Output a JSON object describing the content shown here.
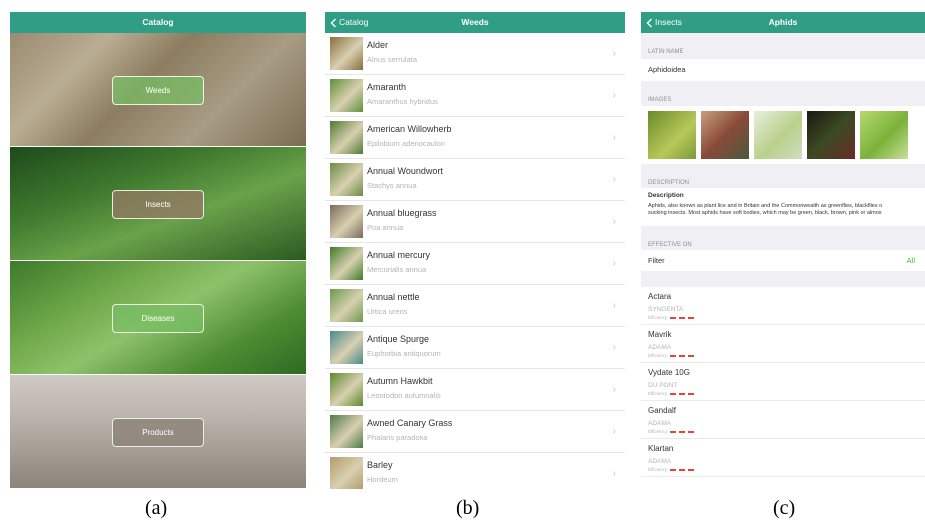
{
  "panel_a": {
    "title": "Catalog",
    "categories": [
      {
        "label": "Weeds"
      },
      {
        "label": "Insects"
      },
      {
        "label": "Diseases"
      },
      {
        "label": "Products"
      }
    ]
  },
  "panel_b": {
    "back_label": "Catalog",
    "title": "Weeds",
    "items": [
      {
        "name": "Alder",
        "latin": "Alnus serrulata",
        "thumb_color": "#8a6d3b"
      },
      {
        "name": "Amaranth",
        "latin": "Amaranthus hybridus",
        "thumb_color": "#5f8f3a"
      },
      {
        "name": "American Willowherb",
        "latin": "Epilobium adenocaulon",
        "thumb_color": "#4e7a33"
      },
      {
        "name": "Annual Woundwort",
        "latin": "Stachys annua",
        "thumb_color": "#6d8a45"
      },
      {
        "name": "Annual bluegrass",
        "latin": "Poa annua",
        "thumb_color": "#7a6a5a"
      },
      {
        "name": "Annual mercury",
        "latin": "Mercurialis annua",
        "thumb_color": "#3f7a2a"
      },
      {
        "name": "Annual nettle",
        "latin": "Urtica urens",
        "thumb_color": "#6a9a4a"
      },
      {
        "name": "Antique Spurge",
        "latin": "Euphorbia antiquorum",
        "thumb_color": "#4a8a8a"
      },
      {
        "name": "Autumn Hawkbit",
        "latin": "Leontodon autumnalis",
        "thumb_color": "#5a8a2a"
      },
      {
        "name": "Awned Canary Grass",
        "latin": "Phalaris paradoxa",
        "thumb_color": "#4f7a4a"
      },
      {
        "name": "Barley",
        "latin": "Hordeum",
        "thumb_color": "#b59a6a"
      }
    ]
  },
  "panel_c": {
    "back_label": "Insects",
    "title": "Aphids",
    "latin_header": "LATIN NAME",
    "latin_name": "Aphidoidea",
    "images_header": "IMAGES",
    "image_colors": [
      "#9ab84a",
      "#c27a5a",
      "#c9d9a0",
      "#2a2a1a",
      "#8ab840"
    ],
    "description_header": "DESCRIPTION",
    "description_title": "Description",
    "description_text": "Aphids, also known as plant lice and in Britain and the Commonwealth as greenflies, blackflies o",
    "description_text_2": "sucking insects. Most aphids have soft bodies, which may be green, black, brown, pink or almos",
    "effective_header": "EFFECTIVE ON",
    "filter_label": "Filter",
    "filter_value": "All",
    "efficiency_label": "Efficiency",
    "products": [
      {
        "name": "Actara",
        "company": "SYNGENTA"
      },
      {
        "name": "Mavrik",
        "company": "ADAMA"
      },
      {
        "name": "Vydate 10G",
        "company": "DU PONT"
      },
      {
        "name": "Gandalf",
        "company": "ADAMA"
      },
      {
        "name": "Klartan",
        "company": "ADAMA"
      }
    ]
  },
  "captions": {
    "a": "(a)",
    "b": "(b)",
    "c": "(c)"
  },
  "colors": {
    "accent": "#2f9e84",
    "filter_value": "#4cbb3a",
    "efficiency": "#e0463c"
  }
}
